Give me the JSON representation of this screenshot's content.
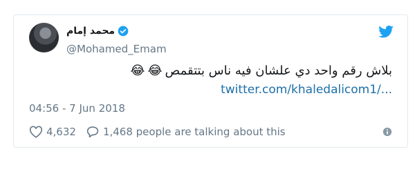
{
  "tweet": {
    "author_name": "محمد إمام",
    "handle": "@Mohamed_Emam",
    "text": "بلاش رقم واحد دي علشان فيه ناس بتتقمص",
    "emojis": [
      "😂",
      "😂"
    ],
    "link_text": "twitter.com/khaledalicom1/...",
    "timestamp": "04:56 - 7 Jun 2018",
    "like_count": "4,632",
    "talking_text": "1,468 people are talking about this"
  },
  "colors": {
    "twitter_blue": "#1da1f2",
    "link": "#1b6fa8",
    "muted": "#657786",
    "border": "#e1e8ed"
  },
  "icons": {
    "verified": "verified-badge-icon",
    "brand": "twitter-bird-icon",
    "like": "heart-icon",
    "reply": "speech-bubble-icon",
    "info": "info-icon"
  }
}
